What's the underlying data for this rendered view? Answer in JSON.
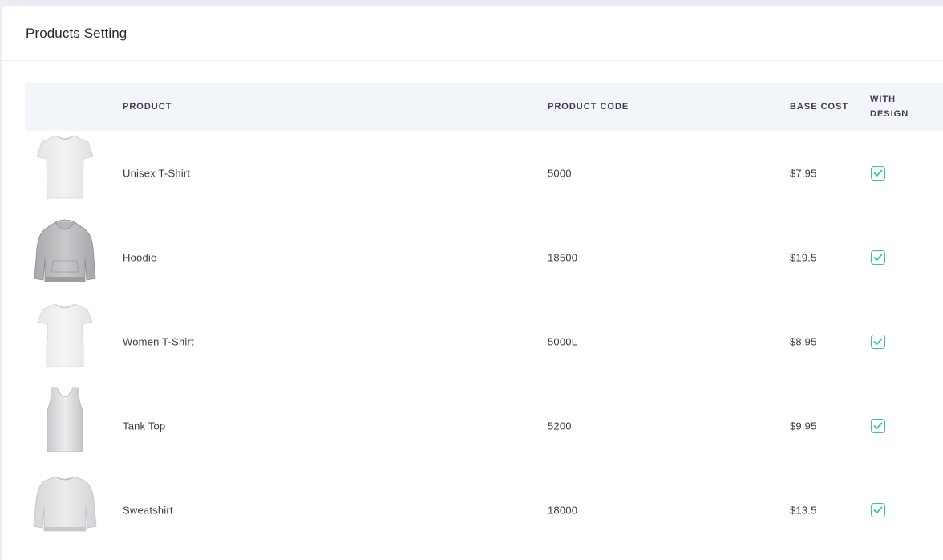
{
  "card": {
    "title": "Products Setting"
  },
  "table": {
    "headers": {
      "product": "PRODUCT",
      "code": "PRODUCT CODE",
      "cost": "BASE COST",
      "design_line1": "WITH",
      "design_line2": "DESIGN"
    },
    "rows": [
      {
        "name": "Unisex T-Shirt",
        "code": "5000",
        "cost": "$7.95",
        "with_design": true,
        "thumb": "tshirt-thumbnail"
      },
      {
        "name": "Hoodie",
        "code": "18500",
        "cost": "$19.5",
        "with_design": true,
        "thumb": "hoodie-thumbnail"
      },
      {
        "name": "Women T-Shirt",
        "code": "5000L",
        "cost": "$8.95",
        "with_design": true,
        "thumb": "women-tshirt-thumbnail"
      },
      {
        "name": "Tank Top",
        "code": "5200",
        "cost": "$9.95",
        "with_design": true,
        "thumb": "tank-top-thumbnail"
      },
      {
        "name": "Sweatshirt",
        "code": "18000",
        "cost": "$13.5",
        "with_design": true,
        "thumb": "sweatshirt-thumbnail"
      }
    ]
  },
  "colors": {
    "check": "#3cc2a2",
    "header_bg": "#f2f5f9",
    "page_bg": "#ecedf3"
  }
}
